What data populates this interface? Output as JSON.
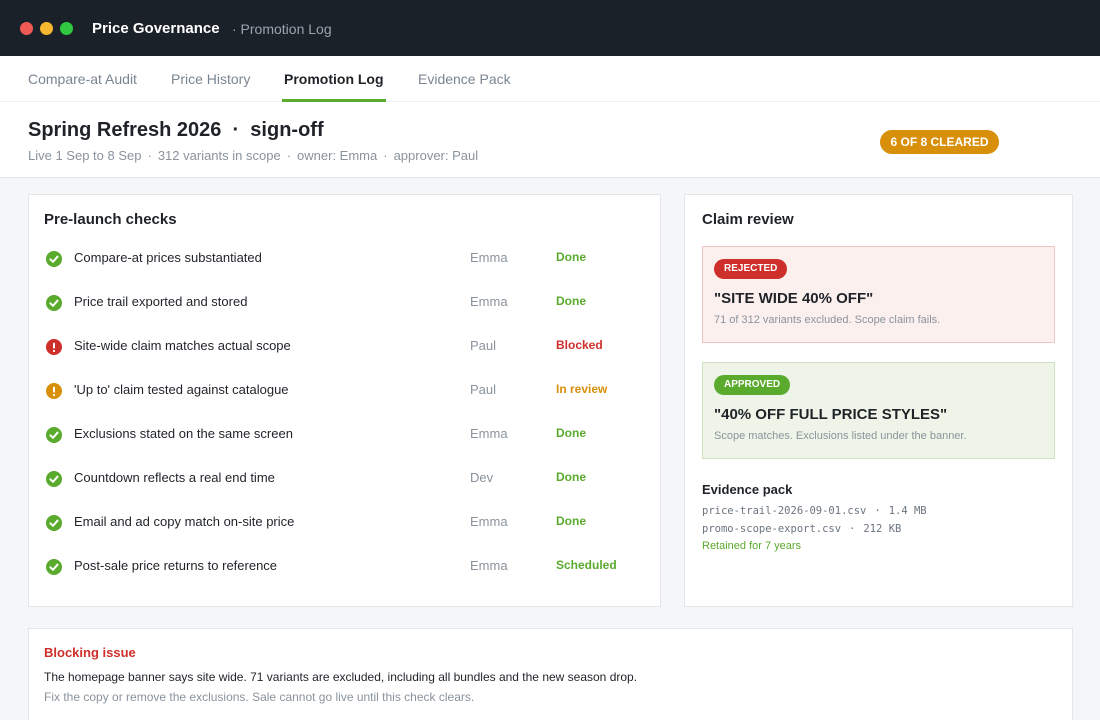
{
  "window": {
    "title": "Price Governance",
    "subtitle": "· Promotion Log"
  },
  "tabs": [
    {
      "label": "Compare-at Audit",
      "active": false
    },
    {
      "label": "Price History",
      "active": false
    },
    {
      "label": "Promotion Log",
      "active": true
    },
    {
      "label": "Evidence Pack",
      "active": false
    }
  ],
  "page": {
    "title": "Spring Refresh 2026  ·  sign-off",
    "meta": {
      "live": "Live 1 Sep to 8 Sep",
      "scope": "312 variants in scope",
      "owner": "owner: Emma",
      "approver": "approver: Paul",
      "separator": "·"
    },
    "cleared_badge": "6 OF 8 CLEARED"
  },
  "checks": {
    "title": "Pre-launch checks",
    "items": [
      {
        "label": "Compare-at prices substantiated",
        "owner": "Emma",
        "status": "Done",
        "state": "ok"
      },
      {
        "label": "Price trail exported and stored",
        "owner": "Emma",
        "status": "Done",
        "state": "ok"
      },
      {
        "label": "Site-wide claim matches actual scope",
        "owner": "Paul",
        "status": "Blocked",
        "state": "blocked"
      },
      {
        "label": "'Up to' claim tested against catalogue",
        "owner": "Paul",
        "status": "In review",
        "state": "review"
      },
      {
        "label": "Exclusions stated on the same screen",
        "owner": "Emma",
        "status": "Done",
        "state": "ok"
      },
      {
        "label": "Countdown reflects a real end time",
        "owner": "Dev",
        "status": "Done",
        "state": "ok"
      },
      {
        "label": "Email and ad copy match on-site price",
        "owner": "Emma",
        "status": "Done",
        "state": "ok"
      },
      {
        "label": "Post-sale price returns to reference",
        "owner": "Emma",
        "status": "Scheduled",
        "state": "ok"
      }
    ]
  },
  "claims": {
    "title": "Claim review",
    "rejected": {
      "badge": "REJECTED",
      "text": "\"SITE WIDE 40% OFF\"",
      "note": "71 of 312 variants excluded. Scope claim fails."
    },
    "approved": {
      "badge": "APPROVED",
      "text": "\"40% OFF FULL PRICE STYLES\"",
      "note": "Scope matches. Exclusions listed under the banner."
    }
  },
  "evidence": {
    "title": "Evidence pack",
    "files": [
      {
        "name": "price-trail-2026-09-01.csv",
        "size": "1.4 MB"
      },
      {
        "name": "promo-scope-export.csv",
        "size": "212 KB"
      }
    ],
    "separator": "·",
    "retention": "Retained for 7 years"
  },
  "blocking": {
    "title": "Blocking issue",
    "text": "The homepage banner says site wide. 71 variants are excluded, including all bundles and the new season drop.",
    "sub": "Fix the copy or remove the exclusions. Sale cannot go live until this check clears."
  },
  "colors": {
    "ok": "#5aaa2e",
    "blocked": "#cf2f2a",
    "review": "#d8900a",
    "titlebar": "#1b2129"
  },
  "icons": {
    "ok": "check-circle-icon",
    "blocked": "alert-circle-icon",
    "review": "warning-circle-icon"
  }
}
